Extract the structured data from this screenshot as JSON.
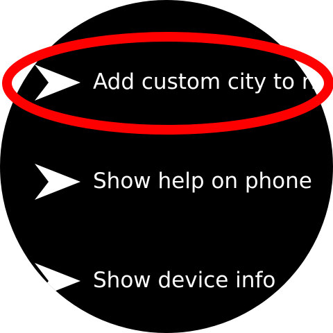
{
  "menu": {
    "items": [
      {
        "label": "Add custom city to ring",
        "icon": "send-arrow-icon"
      },
      {
        "label": "Show help on phone",
        "icon": "send-arrow-icon"
      },
      {
        "label": "Show device info",
        "icon": "send-arrow-icon"
      }
    ]
  },
  "colors": {
    "background": "#000000",
    "text": "#ffffff",
    "highlight": "#ff0000"
  }
}
